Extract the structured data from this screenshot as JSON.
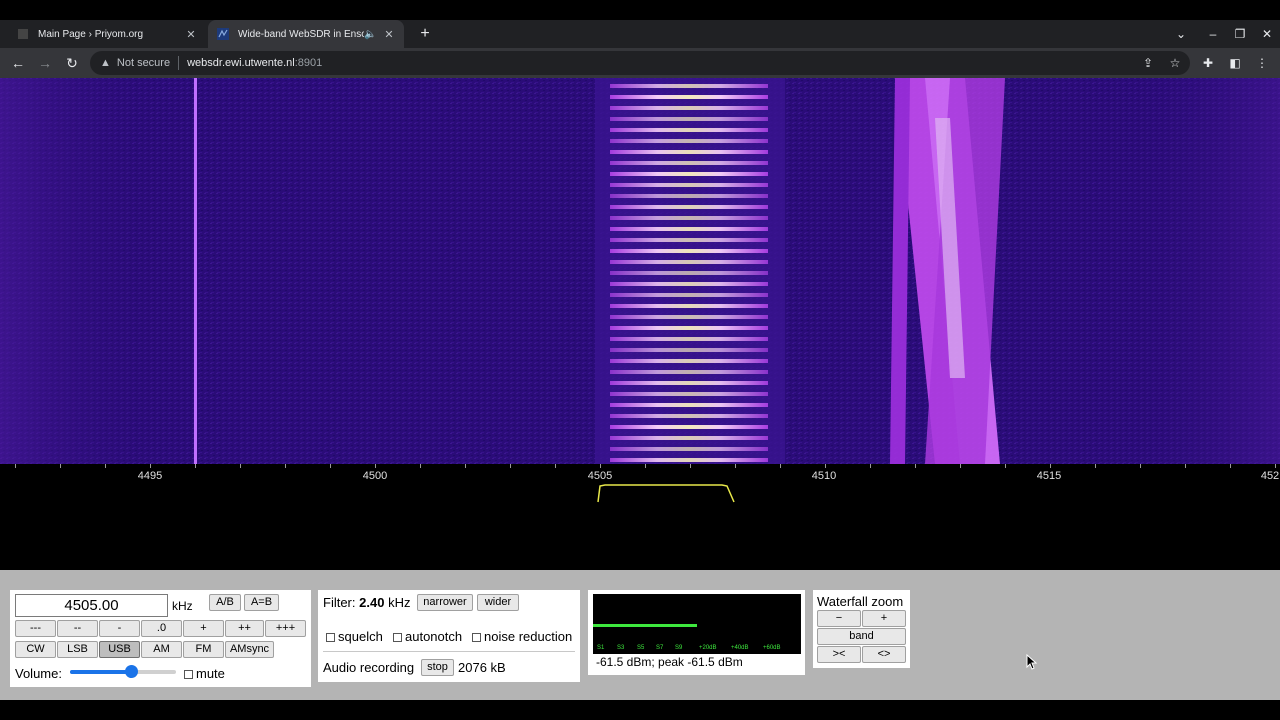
{
  "browser": {
    "tabs": [
      {
        "title": "Main Page › Priyom.org",
        "active": false
      },
      {
        "title": "Wide-band WebSDR in Ensch",
        "active": true,
        "audio": true
      }
    ],
    "omnibox": {
      "security": "Not secure",
      "host": "websdr.ewi.utwente.nl",
      "port": ":8901"
    }
  },
  "scale": {
    "ticks": [
      "4495",
      "4500",
      "4505",
      "4510",
      "4515",
      "452"
    ]
  },
  "frequency": {
    "value": "4505.00",
    "unit": "kHz",
    "ab_label": "A/B",
    "aeqb_label": "A=B",
    "steps": [
      "---",
      "--",
      "-",
      ".0",
      "+",
      "++",
      "+++"
    ],
    "modes": [
      "CW",
      "LSB",
      "USB",
      "AM",
      "FM",
      "AMsync"
    ],
    "selected_mode": "USB",
    "volume_label": "Volume:",
    "volume_level": 0.58,
    "mute_label": "mute"
  },
  "filter": {
    "label": "Filter:",
    "bandwidth": "2.40",
    "unit": "kHz",
    "narrower_label": "narrower",
    "wider_label": "wider",
    "squelch_label": "squelch",
    "autonotch_label": "autonotch",
    "noise_reduction_label": "noise reduction",
    "recording_label": "Audio recording",
    "stop_label": "stop",
    "recording_size": "2076 kB"
  },
  "smeter": {
    "scale_labels": [
      "S1",
      "S3",
      "S5",
      "S7",
      "S9",
      "+20dB",
      "+40dB",
      "+60dB"
    ],
    "level_fraction": 0.5,
    "reading": "-61.5 dBm; peak  -61.5 dBm"
  },
  "waterfall_zoom": {
    "title": "Waterfall zoom",
    "minus_label": "−",
    "plus_label": "+",
    "band_label": "band",
    "shrink_label": "><",
    "expand_label": "<>"
  },
  "colors": {
    "waterfall_bg": "#2a0c78",
    "signal": "#d25cff",
    "passband": "#e8e84a",
    "smeter_bar": "#3ee83e",
    "accent": "#1a73e8"
  }
}
